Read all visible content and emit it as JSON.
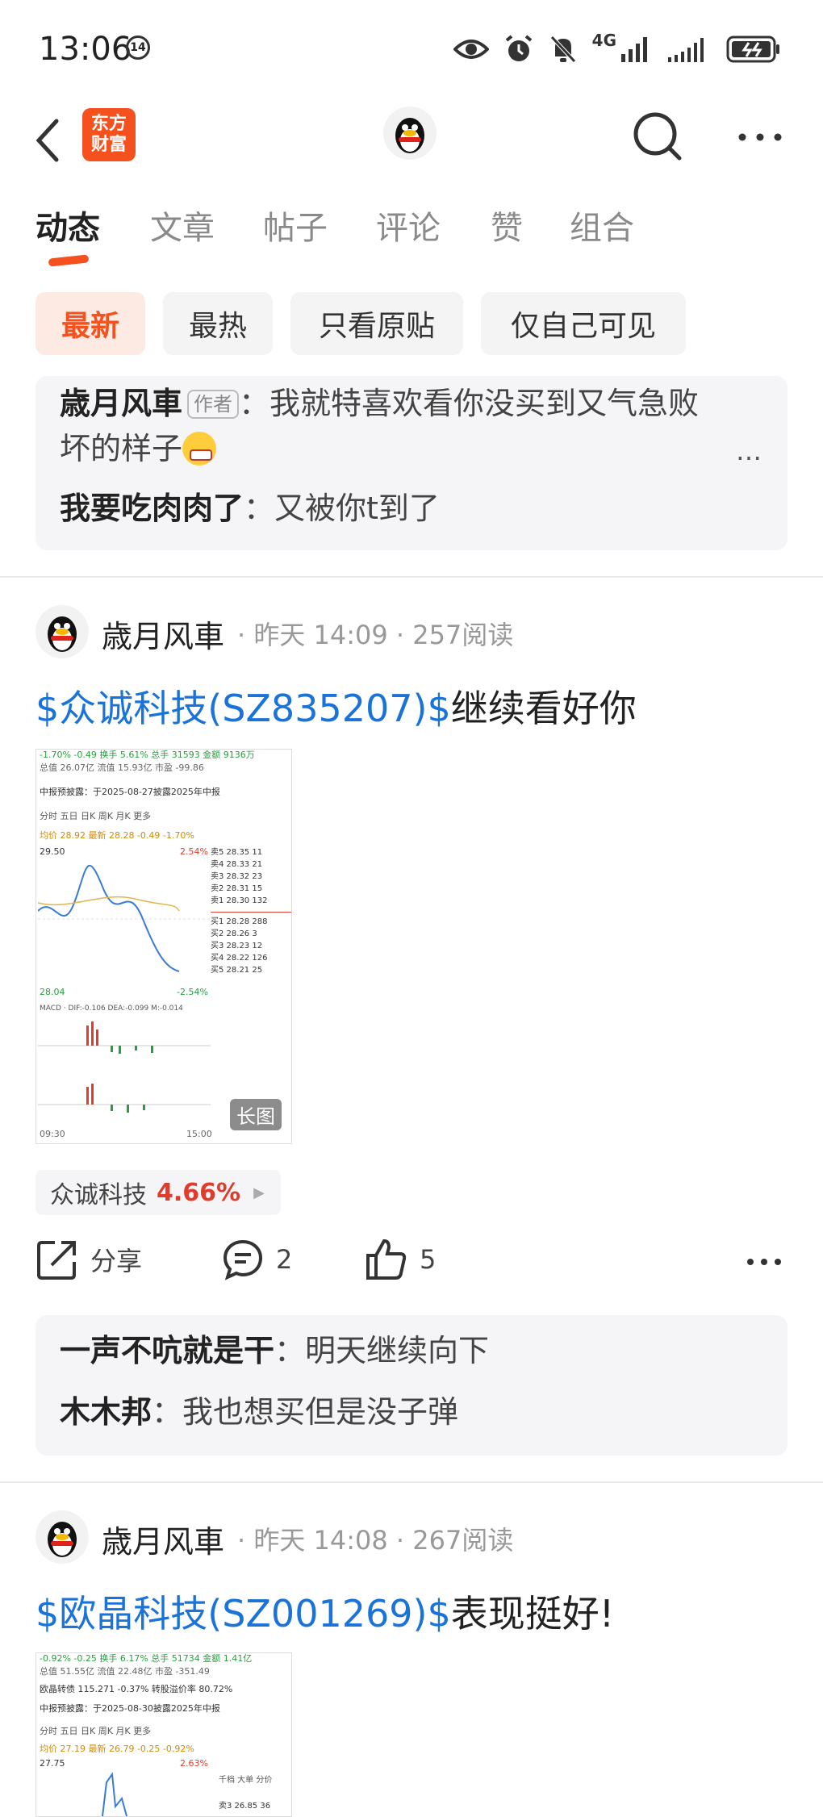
{
  "status": {
    "time": "13:06",
    "time_badge": "14",
    "network": "4G"
  },
  "nav": {
    "logo_text_line1": "东方",
    "logo_text_line2": "财富"
  },
  "tabs": [
    "动态",
    "文章",
    "帖子",
    "评论",
    "赞",
    "组合"
  ],
  "filters": [
    "最新",
    "最热",
    "只看原贴",
    "仅自己可见"
  ],
  "top_comments": {
    "author_tag": "作者",
    "items": [
      {
        "user": "歳月风車",
        "sep": "：",
        "text_line1": "我就特喜欢看你没买到又气急败",
        "text_line2": "坏的样子"
      },
      {
        "user": "我要吃肉肉了",
        "sep": "：",
        "text": "又被你t到了"
      }
    ],
    "more": "…"
  },
  "posts": [
    {
      "user": "歳月风車",
      "meta": "· 昨天 14:09 · 257阅读",
      "stock_link": "$众诚科技(SZ835207)$",
      "title_rest": "继续看好你",
      "shot": {
        "r1": "-1.70% -0.49  换手 5.61%  总手 31593  金额 9136万",
        "r2": "总值 26.07亿  流值 15.93亿  市盈 -99.86",
        "r3": "中报预披露：于2025-08-27披露2025年中报",
        "tabs": "分时  五日  日K  周K  月K  更多",
        "r4": "均价 28.92  最新 28.28 -0.49 -1.70%",
        "hi": "29.50",
        "hi_pct": "2.54%",
        "lo": "28.04",
        "lo_pct": "-2.54%",
        "asks": [
          "卖5 28.35 11",
          "卖4 28.33 21",
          "卖3 28.32 23",
          "卖2 28.31 15",
          "卖1 28.30 132"
        ],
        "bids": [
          "买1 28.28 288",
          "买2 28.26 3",
          "买3 28.23 12",
          "买4 28.22 126",
          "买5 28.21 25"
        ],
        "macd": "MACD · DIF:-0.106 DEA:-0.099 M:-0.014",
        "t_start": "09:30",
        "t_end": "15:00",
        "long_tag": "长图"
      },
      "stock_chip": {
        "name": "众诚科技",
        "pct": "4.66%"
      },
      "actions": {
        "share": "分享",
        "comments": "2",
        "likes": "5"
      },
      "comments": [
        {
          "user": "一声不吭就是干",
          "sep": "：",
          "text": "明天继续向下"
        },
        {
          "user": "木木邦",
          "sep": "：",
          "text": "我也想买但是没子弹"
        }
      ]
    },
    {
      "user": "歳月风車",
      "meta": "· 昨天 14:08 · 267阅读",
      "stock_link": "$欧晶科技(SZ001269)$",
      "title_rest": "表现挺好!",
      "shot": {
        "r1": "-0.92% -0.25  换手 6.17%  总手 51734  金额 1.41亿",
        "r2": "总值 51.55亿  流值 22.48亿  市盈 -351.49",
        "r2b": "欧晶转债 115.271 -0.37%  转股溢价率 80.72%",
        "r3": "中报预披露：于2025-08-30披露2025年中报",
        "tabs": "分时  五日  日K  周K  月K  更多",
        "r4": "均价 27.19  最新 26.79 -0.25 -0.92%",
        "hi": "27.75",
        "hi_pct": "2.63%",
        "side": "千档  大单  分价",
        "ask3": "卖3 26.85 36"
      }
    }
  ]
}
